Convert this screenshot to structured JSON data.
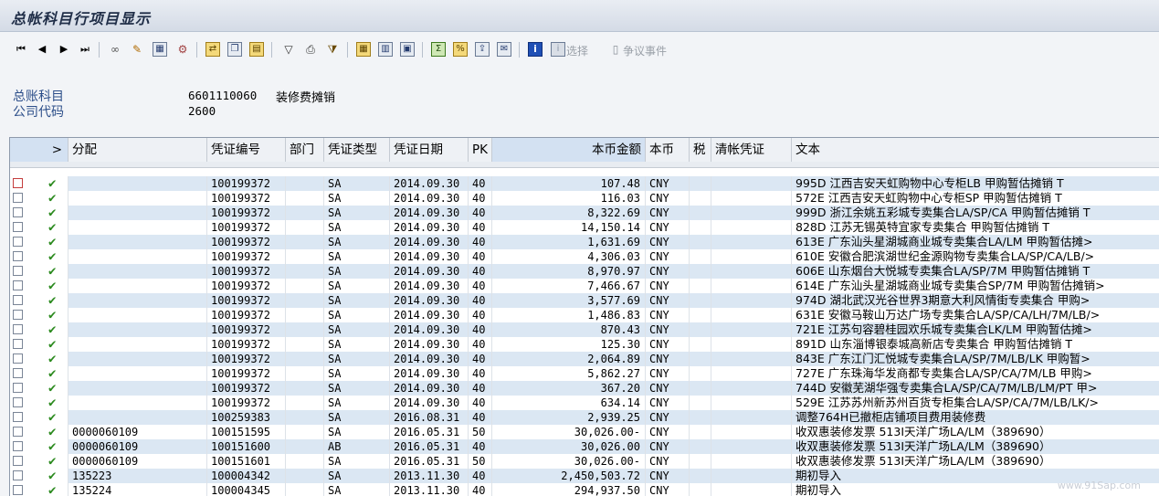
{
  "window": {
    "title": "总帐科目行项目显示"
  },
  "toolbar": {
    "select_label": "选择",
    "event_label": "争议事件"
  },
  "header": {
    "gl_account_label": "总账科目",
    "gl_account_value": "6601110060",
    "gl_account_desc": "装修费摊销",
    "company_code_label": "公司代码",
    "company_code_value": "2600"
  },
  "table": {
    "columns": {
      "sel": ">",
      "assignment": "分配",
      "doc_no": "凭证编号",
      "dept": "部门",
      "doc_type": "凭证类型",
      "doc_date": "凭证日期",
      "pk": "PK",
      "amount": "本币金额",
      "currency": "本币",
      "tax": "税",
      "clearing": "清帐凭证",
      "text": "文本"
    },
    "rows": [
      {
        "assignment": "",
        "doc_no": "100199372",
        "doc_type": "SA",
        "doc_date": "2014.09.30",
        "pk": "40",
        "amount": "107.48",
        "currency": "CNY",
        "text": "995D 江西吉安天虹购物中心专柜LB 甲购暂估摊销 T"
      },
      {
        "assignment": "",
        "doc_no": "100199372",
        "doc_type": "SA",
        "doc_date": "2014.09.30",
        "pk": "40",
        "amount": "116.03",
        "currency": "CNY",
        "text": "572E 江西吉安天虹购物中心专柜SP 甲购暂估摊销 T"
      },
      {
        "assignment": "",
        "doc_no": "100199372",
        "doc_type": "SA",
        "doc_date": "2014.09.30",
        "pk": "40",
        "amount": "8,322.69",
        "currency": "CNY",
        "text": "999D 浙江余姚五彩城专卖集合LA/SP/CA 甲购暂估摊销 T"
      },
      {
        "assignment": "",
        "doc_no": "100199372",
        "doc_type": "SA",
        "doc_date": "2014.09.30",
        "pk": "40",
        "amount": "14,150.14",
        "currency": "CNY",
        "text": "828D 江苏无锡英特宜家专卖集合 甲购暂估摊销 T"
      },
      {
        "assignment": "",
        "doc_no": "100199372",
        "doc_type": "SA",
        "doc_date": "2014.09.30",
        "pk": "40",
        "amount": "1,631.69",
        "currency": "CNY",
        "text": "613E 广东汕头星湖城商业城专卖集合LA/LM 甲购暂估摊>"
      },
      {
        "assignment": "",
        "doc_no": "100199372",
        "doc_type": "SA",
        "doc_date": "2014.09.30",
        "pk": "40",
        "amount": "4,306.03",
        "currency": "CNY",
        "text": "610E 安徽合肥滨湖世纪金源购物专卖集合LA/SP/CA/LB/>"
      },
      {
        "assignment": "",
        "doc_no": "100199372",
        "doc_type": "SA",
        "doc_date": "2014.09.30",
        "pk": "40",
        "amount": "8,970.97",
        "currency": "CNY",
        "text": "606E 山东烟台大悦城专卖集合LA/SP/7M 甲购暂估摊销 T"
      },
      {
        "assignment": "",
        "doc_no": "100199372",
        "doc_type": "SA",
        "doc_date": "2014.09.30",
        "pk": "40",
        "amount": "7,466.67",
        "currency": "CNY",
        "text": "614E 广东汕头星湖城商业城专卖集合SP/7M 甲购暂估摊销>"
      },
      {
        "assignment": "",
        "doc_no": "100199372",
        "doc_type": "SA",
        "doc_date": "2014.09.30",
        "pk": "40",
        "amount": "3,577.69",
        "currency": "CNY",
        "text": "974D 湖北武汉光谷世界3期意大利风情街专卖集合 甲购>"
      },
      {
        "assignment": "",
        "doc_no": "100199372",
        "doc_type": "SA",
        "doc_date": "2014.09.30",
        "pk": "40",
        "amount": "1,486.83",
        "currency": "CNY",
        "text": "631E 安徽马鞍山万达广场专卖集合LA/SP/CA/LH/7M/LB/>"
      },
      {
        "assignment": "",
        "doc_no": "100199372",
        "doc_type": "SA",
        "doc_date": "2014.09.30",
        "pk": "40",
        "amount": "870.43",
        "currency": "CNY",
        "text": "721E 江苏句容碧桂园欢乐城专卖集合LK/LM 甲购暂估摊>"
      },
      {
        "assignment": "",
        "doc_no": "100199372",
        "doc_type": "SA",
        "doc_date": "2014.09.30",
        "pk": "40",
        "amount": "125.30",
        "currency": "CNY",
        "text": "891D 山东淄博银泰城高新店专卖集合 甲购暂估摊销 T"
      },
      {
        "assignment": "",
        "doc_no": "100199372",
        "doc_type": "SA",
        "doc_date": "2014.09.30",
        "pk": "40",
        "amount": "2,064.89",
        "currency": "CNY",
        "text": "843E 广东江门汇悦城专卖集合LA/SP/7M/LB/LK 甲购暂>"
      },
      {
        "assignment": "",
        "doc_no": "100199372",
        "doc_type": "SA",
        "doc_date": "2014.09.30",
        "pk": "40",
        "amount": "5,862.27",
        "currency": "CNY",
        "text": "727E 广东珠海华发商都专卖集合LA/SP/CA/7M/LB 甲购>"
      },
      {
        "assignment": "",
        "doc_no": "100199372",
        "doc_type": "SA",
        "doc_date": "2014.09.30",
        "pk": "40",
        "amount": "367.20",
        "currency": "CNY",
        "text": "744D 安徽芜湖华强专卖集合LA/SP/CA/7M/LB/LM/PT 甲>"
      },
      {
        "assignment": "",
        "doc_no": "100199372",
        "doc_type": "SA",
        "doc_date": "2014.09.30",
        "pk": "40",
        "amount": "634.14",
        "currency": "CNY",
        "text": "529E 江苏苏州新苏州百货专柜集合LA/SP/CA/7M/LB/LK/>"
      },
      {
        "assignment": "",
        "doc_no": "100259383",
        "doc_type": "SA",
        "doc_date": "2016.08.31",
        "pk": "40",
        "amount": "2,939.25",
        "currency": "CNY",
        "text": "调整764H已撤柜店铺项目费用装修费"
      },
      {
        "assignment": "0000060109",
        "doc_no": "100151595",
        "doc_type": "SA",
        "doc_date": "2016.05.31",
        "pk": "50",
        "amount": "30,026.00-",
        "currency": "CNY",
        "text": "收双惠装修发票 513I天洋广场LA/LM（389690）"
      },
      {
        "assignment": "0000060109",
        "doc_no": "100151600",
        "doc_type": "AB",
        "doc_date": "2016.05.31",
        "pk": "40",
        "amount": "30,026.00",
        "currency": "CNY",
        "text": "收双惠装修发票 513I天洋广场LA/LM（389690）"
      },
      {
        "assignment": "0000060109",
        "doc_no": "100151601",
        "doc_type": "SA",
        "doc_date": "2016.05.31",
        "pk": "50",
        "amount": "30,026.00-",
        "currency": "CNY",
        "text": "收双惠装修发票 513I天洋广场LA/LM（389690）"
      },
      {
        "assignment": "135223",
        "doc_no": "100004342",
        "doc_type": "SA",
        "doc_date": "2013.11.30",
        "pk": "40",
        "amount": "2,450,503.72",
        "currency": "CNY",
        "text": "期初导入"
      },
      {
        "assignment": "135224",
        "doc_no": "100004345",
        "doc_type": "SA",
        "doc_date": "2013.11.30",
        "pk": "40",
        "amount": "294,937.50",
        "currency": "CNY",
        "text": "期初导入"
      }
    ]
  },
  "watermark": "www.91Sap.com"
}
